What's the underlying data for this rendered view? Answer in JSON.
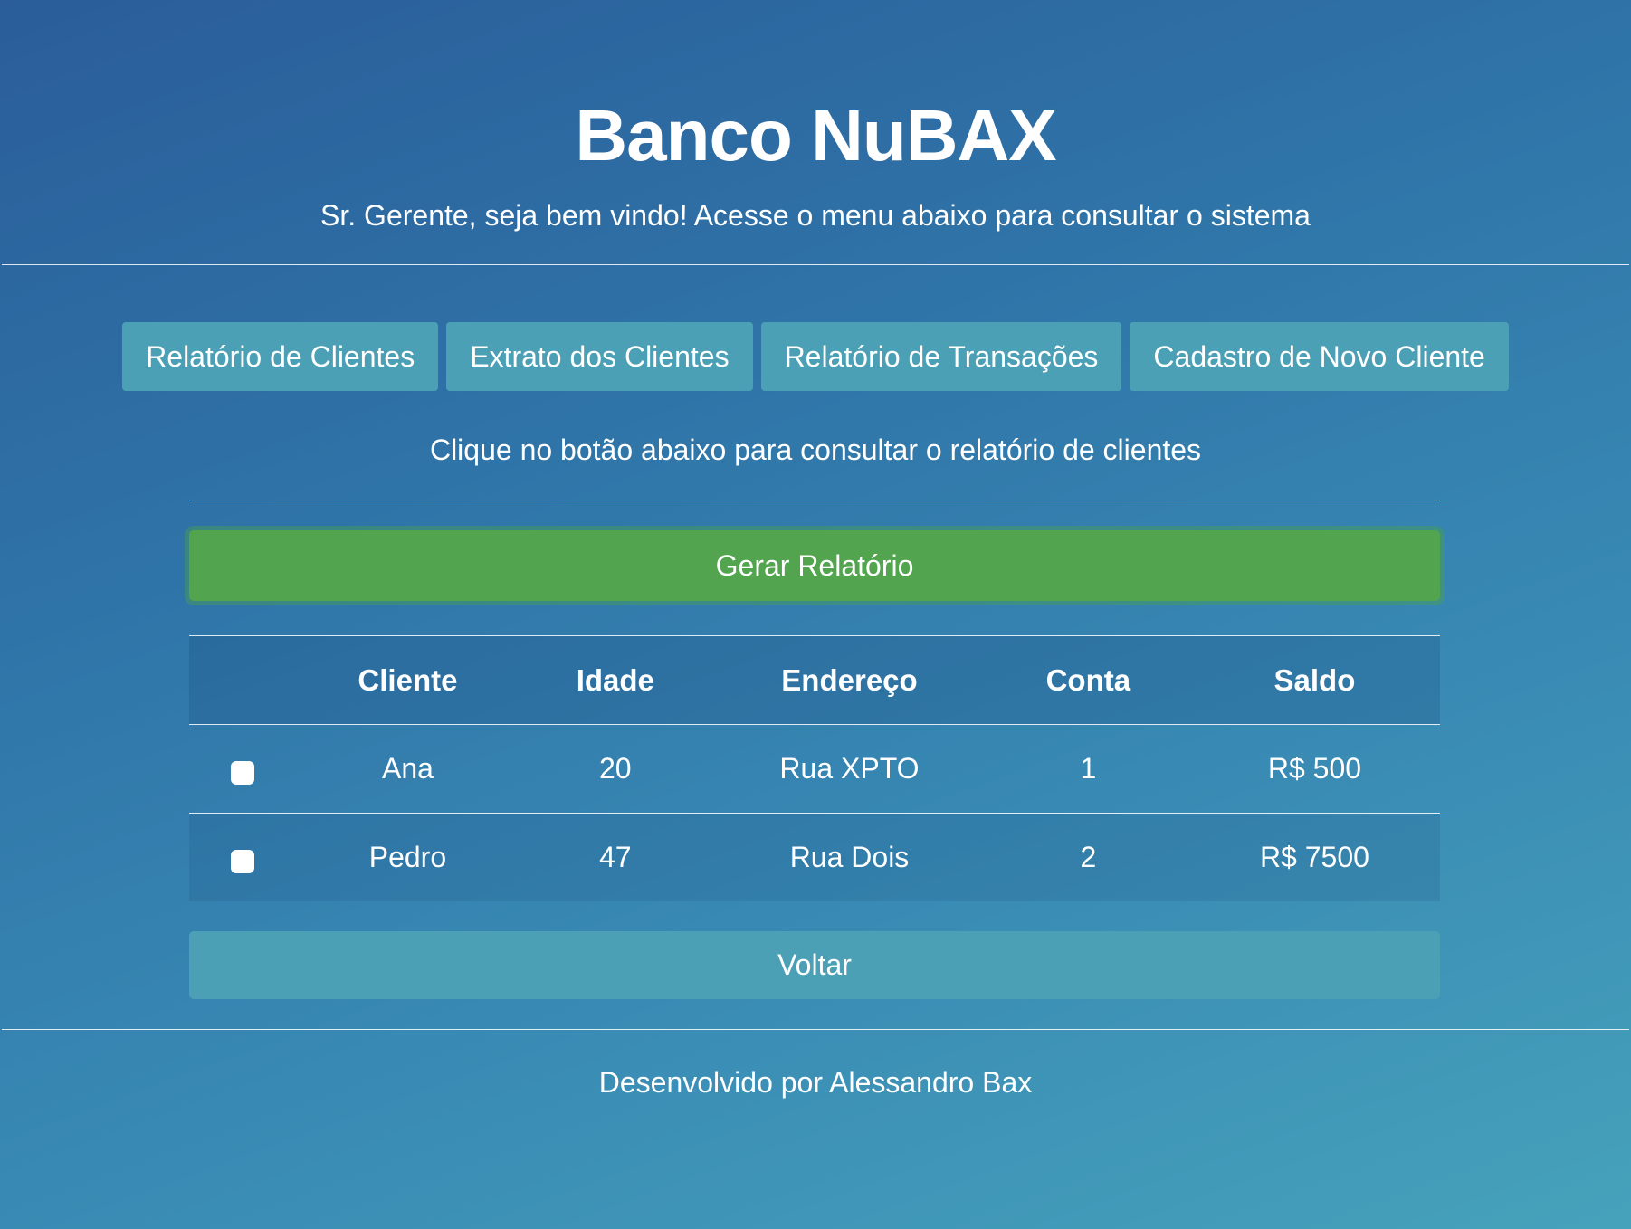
{
  "header": {
    "title": "Banco NuBAX",
    "subtitle": "Sr. Gerente, seja bem vindo! Acesse o menu abaixo para consultar o sistema"
  },
  "menu": {
    "items": [
      {
        "label": "Relatório de Clientes"
      },
      {
        "label": "Extrato dos Clientes"
      },
      {
        "label": "Relatório de Transações"
      },
      {
        "label": "Cadastro de Novo Cliente"
      }
    ]
  },
  "main": {
    "instruction": "Clique no botão abaixo para consultar o relatório de clientes",
    "generate_label": "Gerar Relatório",
    "back_label": "Voltar"
  },
  "table": {
    "headers": [
      "",
      "Cliente",
      "Idade",
      "Endereço",
      "Conta",
      "Saldo"
    ],
    "rows": [
      {
        "checked": false,
        "cliente": "Ana",
        "idade": "20",
        "endereco": "Rua XPTO",
        "conta": "1",
        "saldo": "R$ 500"
      },
      {
        "checked": false,
        "cliente": "Pedro",
        "idade": "47",
        "endereco": "Rua Dois",
        "conta": "2",
        "saldo": "R$ 7500"
      }
    ]
  },
  "footer": {
    "text": "Desenvolvido por Alessandro Bax"
  },
  "colors": {
    "menu_button": "#4ba0b6",
    "generate_button": "#52a44f",
    "background_start": "#2a5d9a",
    "background_end": "#46a2bb"
  }
}
